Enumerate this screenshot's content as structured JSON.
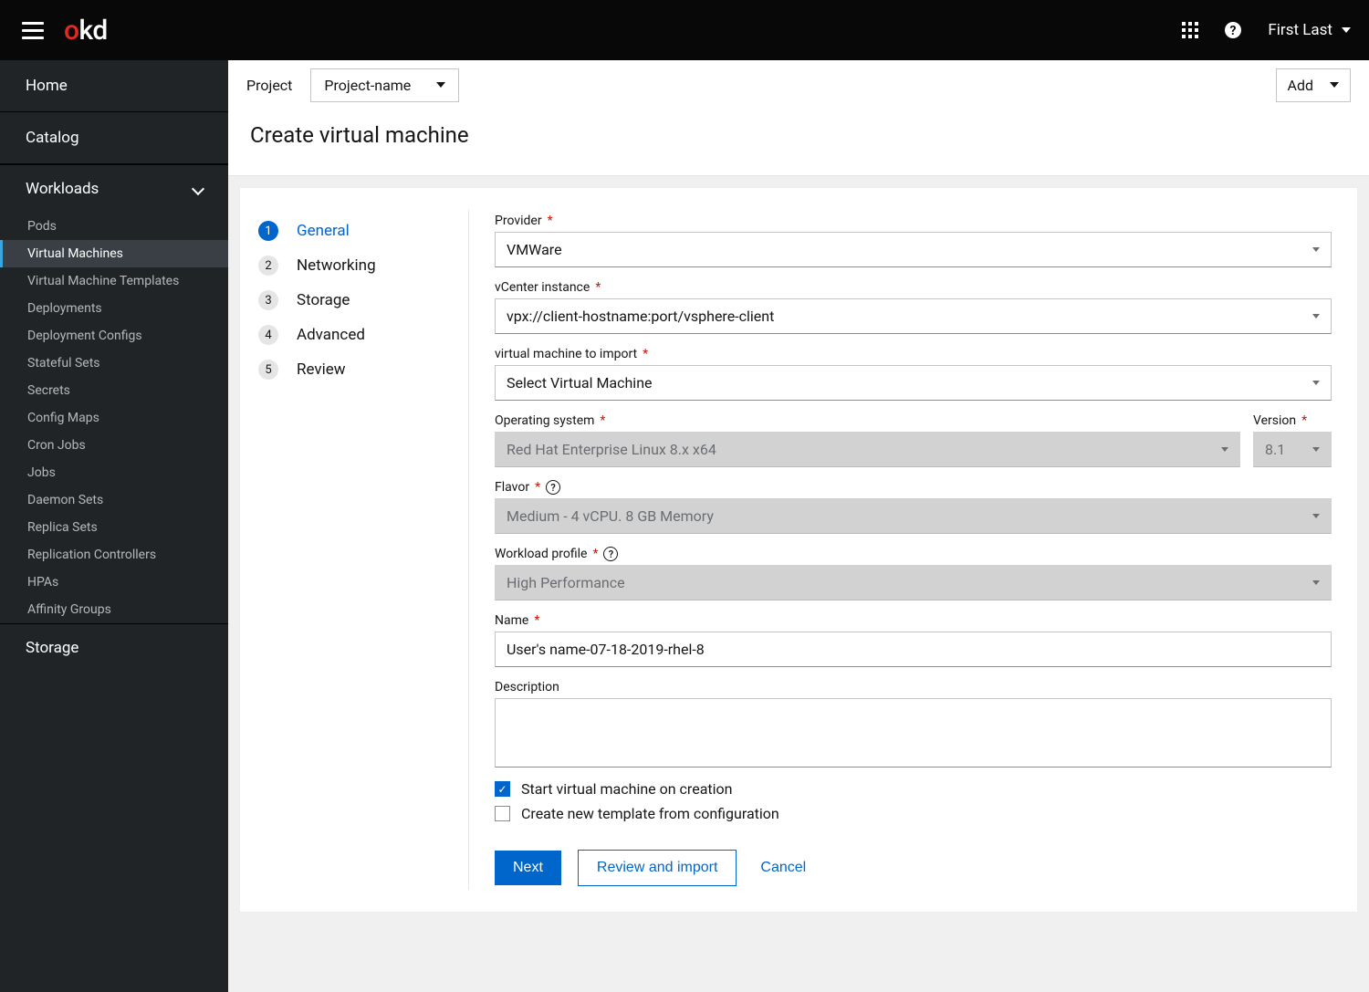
{
  "brand": {
    "o": "o",
    "kd": "kd"
  },
  "header": {
    "user": "First Last"
  },
  "sidebar": {
    "top": [
      {
        "label": "Home"
      },
      {
        "label": "Catalog"
      }
    ],
    "section_workloads": "Workloads",
    "workloads": [
      "Pods",
      "Virtual Machines",
      "Virtual Machine Templates",
      "Deployments",
      "Deployment Configs",
      "Stateful Sets",
      "Secrets",
      "Config Maps",
      "Cron Jobs",
      "Jobs",
      "Daemon Sets",
      "Replica Sets",
      "Replication Controllers",
      "HPAs",
      "Affinity Groups"
    ],
    "workloads_active_index": 1,
    "section_storage": "Storage"
  },
  "projectbar": {
    "label": "Project",
    "project": "Project-name",
    "add": "Add"
  },
  "page": {
    "title": "Create virtual machine"
  },
  "wizard": {
    "steps": [
      "General",
      "Networking",
      "Storage",
      "Advanced",
      "Review"
    ],
    "active_index": 0
  },
  "form": {
    "provider_label": "Provider",
    "provider_value": "VMWare",
    "vcenter_label": "vCenter instance",
    "vcenter_value": "vpx://client-hostname:port/vsphere-client",
    "vm_import_label": "virtual machine to import",
    "vm_import_value": "Select Virtual Machine",
    "os_label": "Operating system",
    "os_value": "Red Hat Enterprise Linux 8.x x64",
    "version_label": "Version",
    "version_value": "8.1",
    "flavor_label": "Flavor",
    "flavor_value": "Medium - 4 vCPU. 8 GB Memory",
    "workload_label": "Workload profile",
    "workload_value": "High Performance",
    "name_label": "Name",
    "name_value": "User's name-07-18-2019-rhel-8",
    "description_label": "Description",
    "check_start_label": "Start virtual machine on creation",
    "check_template_label": "Create new template from configuration"
  },
  "buttons": {
    "next": "Next",
    "review_import": "Review and import",
    "cancel": "Cancel"
  }
}
